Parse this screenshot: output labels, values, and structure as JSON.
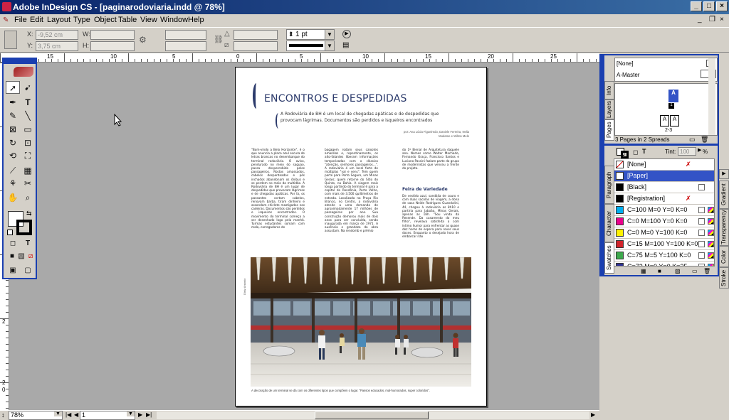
{
  "window": {
    "title": "Adobe InDesign CS - [paginarodoviaria.indd @ 78%]",
    "controls": [
      "_",
      "□",
      "×"
    ]
  },
  "menu": [
    "File",
    "Edit",
    "Layout",
    "Type",
    "Object",
    "Table",
    "View",
    "Window",
    "Help"
  ],
  "control_panel": {
    "x_label": "X:",
    "x_value": "-9,52 cm",
    "y_label": "Y:",
    "y_value": "3,75 cm",
    "w_label": "W:",
    "h_label": "H:",
    "stroke_weight": "1 pt"
  },
  "rulers": {
    "h_numbers": [
      "15",
      "10",
      "5",
      "0",
      "5",
      "10",
      "15",
      "20",
      "25"
    ],
    "v_numbers": [
      "2",
      "2",
      "5",
      "2",
      "0"
    ]
  },
  "document": {
    "title": "ENCONTROS E DESPEDIDAS",
    "subtitle": "A Rodoviária de BH é um local de chegadas apáticas e de despedidas que provocam lágrimas. Documentos são perdidos e isqueiros encontrados",
    "authors": "por: Ana Lúcia Figueiredo, Daniele Ferreira, Nelia Mudame e Wilton Melo",
    "col1": "\"Bom-vindo a Belo Horizonte\", é o que anuncia a placa azul escura de letras brancas no desembarque do terminal rodoviário. O aviso, pendurado no meio do saguao, passa despercebido pelos passageiros. Rostos amassados, cabelos despenteados e pés inchados abandonam os ônibus e se perdem no meio da multidão. A Rodoviária de BH é um lugar de despedidas que provocam lágrimas e de chegadas apáticas. Por lá, os passantes cortam cabelos, renovam barba, tiram dinheiro e assondam chiclete mastigados nas cadeiras. Documentos são perdidos e isqueiros encontrados. O movimento do terminal começa a ser desenhado logo pela manhã. Turmas estudantes somam com mala, carregadores de",
    "col2": "bagagem rodam seus caixotes amarelos e, repentinamente, os alto-falantes liberam informações temporizadas com o clássico \"atenção, senhores passageiros...\". A rodoviária é um local farto de múltiplas \"vai e vens\". Tem quem parte para Porto Seguro, um Minas Gerais; quem retorne do Sítio do Quinto, na Bahia. A viagem mais longa partindo do terminal é para a capital do Rondônia, Porto Velho, com mais de 3.500 quilômetros de estrada. Localizada na Praça Rio Branco, no Centro, a rodoviária atende a uma demanda de aproximadamente 17 milhões de passageiros por ano. Sua construção demorou mais de dois anos para ser concluída, sendo inaugurada em março de 1971. A ausência e grandeza da obra assustam. Na rendomb e prêmio",
    "col3a": "do 1º Bienal de Arquitetura daquele ano. Nomes como Walter Machado, Fernando Graça, Francisco Santos e Luciano Passini faziam parte do grupo de modernistas que venceu a frente do projeto.",
    "subhead": "Feira de Variedade",
    "col3b": "De vestido azul, sandália de couro e com duas sacolas de viagem, a dona de casa Neide Rodrigues Guandalini, 44, chegou à rodoviária as 8h10 e partiria para Jaboão, Minas Gerais, apenas às 18h. \"Sou vinda da Resende. Da casamento do meu filho\", revelava satisfeita a com íntimo humor para enfrentar as quase dez horas de espera para rever seus doces. Enquanto o desejado hora de embarcar não",
    "side_caption": "Diniz Antonio",
    "caption": "A decoração de um terminal se dá com os diferentes tipos que compõem o lugar. \"Passos educados, mal-humorados, super coloridos\"."
  },
  "status_bar": {
    "zoom": "78%",
    "page": "1"
  },
  "pages_panel": {
    "tabs": [
      "Pages",
      "Layers",
      "Info"
    ],
    "none_label": "[None]",
    "master_label": "A-Master",
    "spread_label": "2-3",
    "status": "3 Pages in 2 Spreads",
    "page_letters": [
      "A",
      "A",
      "A"
    ],
    "page1_number": "1"
  },
  "swatches_panel": {
    "tabs": [
      "Swatches",
      "Character Styles",
      "Paragraph Styles"
    ],
    "right_tabs": [
      "Gradient",
      "Transparency",
      "Color",
      "Stroke"
    ],
    "tint_label": "Tint:",
    "tint_value": "100",
    "tint_unit": "%",
    "swatches": [
      {
        "name": "[None]",
        "color": "#ffffff"
      },
      {
        "name": "[Paper]",
        "color": "#ffffff"
      },
      {
        "name": "[Black]",
        "color": "#000000"
      },
      {
        "name": "[Registration]",
        "color": "#000000"
      },
      {
        "name": "C=100 M=0 Y=0 K=0",
        "color": "#00aeef"
      },
      {
        "name": "C=0 M=100 Y=0 K=0",
        "color": "#ec008c"
      },
      {
        "name": "C=0 M=0 Y=100 K=0",
        "color": "#fff200"
      },
      {
        "name": "C=15 M=100 Y=100 K=0",
        "color": "#d2232a"
      },
      {
        "name": "C=75 M=5 Y=100 K=0",
        "color": "#3da94d"
      },
      {
        "name": "C=72 M=0 Y=0 K=25",
        "color": "#2e3192"
      }
    ]
  },
  "colors": {
    "accent": "#1a3fb0",
    "title_blue": "#2b3a6b",
    "selection": "#3353c6"
  }
}
